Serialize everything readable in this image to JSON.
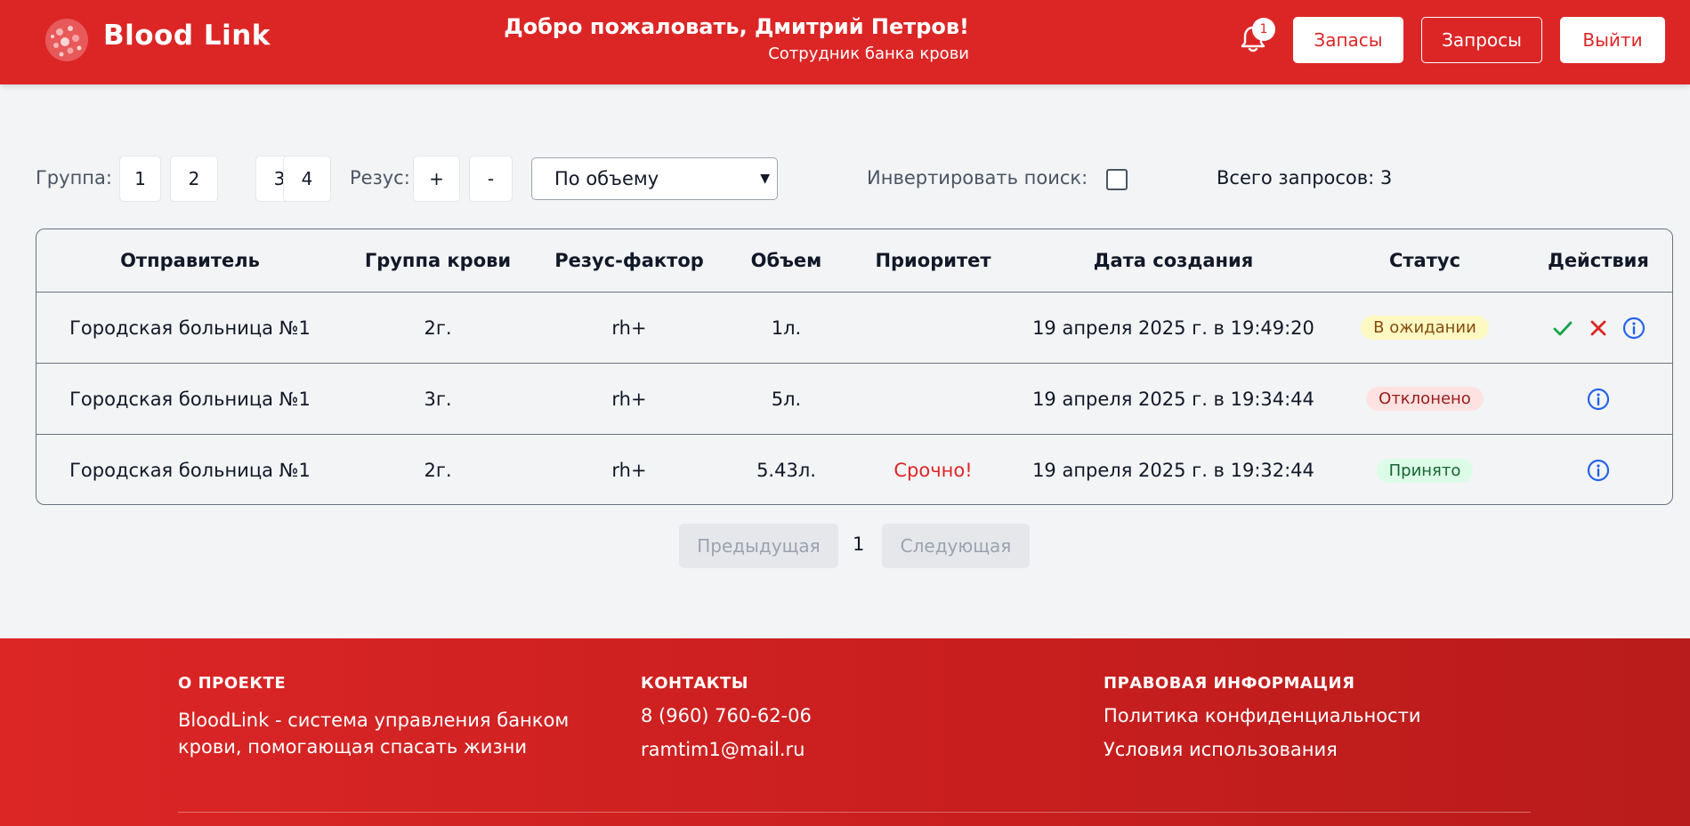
{
  "header": {
    "brand": "Blood Link",
    "welcome": "Добро пожаловать, Дмитрий Петров!",
    "role": "Сотрудник банка крови",
    "notifications_count": "1",
    "buttons": {
      "stock": "Запасы",
      "requests": "Запросы",
      "logout": "Выйти"
    }
  },
  "filters": {
    "group_label": "Группа:",
    "groups": [
      "1",
      "2",
      "3",
      "4"
    ],
    "rhesus_label": "Резус:",
    "rhesus": [
      "+",
      "-"
    ],
    "sort_selected": "По объему",
    "invert_label": "Инвертировать поиск:",
    "invert_checked": false,
    "total": "Всего запросов: 3"
  },
  "table": {
    "headers": {
      "sender": "Отправитель",
      "blood_group": "Группа крови",
      "rhesus": "Резус-фактор",
      "volume": "Объем",
      "priority": "Приоритет",
      "created": "Дата создания",
      "status": "Статус",
      "actions": "Действия"
    },
    "rows": [
      {
        "sender": "Городская больница №1",
        "blood_group": "2г.",
        "rhesus": "rh+",
        "volume": "1л.",
        "priority": "",
        "created": "19 апреля 2025 г. в 19:49:20",
        "status": "В ожидании",
        "status_type": "pending",
        "actions": [
          "check-icon",
          "cross-icon",
          "info-icon"
        ]
      },
      {
        "sender": "Городская больница №1",
        "blood_group": "3г.",
        "rhesus": "rh+",
        "volume": "5л.",
        "priority": "",
        "created": "19 апреля 2025 г. в 19:34:44",
        "status": "Отклонено",
        "status_type": "rejected",
        "actions": [
          "info-icon"
        ]
      },
      {
        "sender": "Городская больница №1",
        "blood_group": "2г.",
        "rhesus": "rh+",
        "volume": "5.43л.",
        "priority": "Срочно!",
        "created": "19 апреля 2025 г. в 19:32:44",
        "status": "Принято",
        "status_type": "accepted",
        "actions": [
          "info-icon"
        ]
      }
    ]
  },
  "pagination": {
    "prev": "Предыдущая",
    "current": "1",
    "next": "Следующая"
  },
  "footer": {
    "about_title": "О ПРОЕКТЕ",
    "about_text": "BloodLink - система управления банком крови, помогающая спасать жизни",
    "contacts_title": "КОНТАКТЫ",
    "phone": "8 (960) 760-62-06",
    "email": "ramtim1@mail.ru",
    "legal_title": "ПРАВОВАЯ ИНФОРМАЦИЯ",
    "privacy": "Политика конфиденциальности",
    "terms": "Условия использования"
  },
  "colors": {
    "brand": "#dc2626",
    "accept": "#16a34a",
    "reject": "#dc2626",
    "info": "#2563eb"
  }
}
